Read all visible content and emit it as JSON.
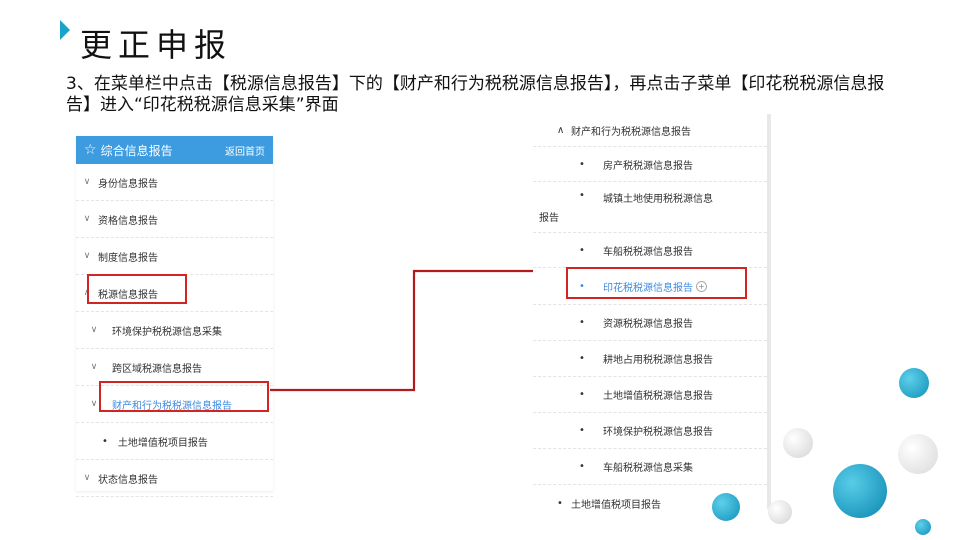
{
  "slide": {
    "title": "更正申报",
    "instruction": "3、在菜单栏中点击【税源信息报告】下的【财产和行为税税源信息报告】，再点击子菜单【印花税税源信息报告】进入“印花税税源信息采集”界面"
  },
  "left_menu": {
    "header_title": "综合信息报告",
    "home_link": "返回首页",
    "items": [
      {
        "arrow": "∨",
        "label": "身份信息报告"
      },
      {
        "arrow": "∨",
        "label": "资格信息报告"
      },
      {
        "arrow": "∨",
        "label": "制度信息报告"
      },
      {
        "arrow": "∧",
        "label": "税源信息报告"
      },
      {
        "arrow": "∨",
        "label": "环境保护税税源信息采集"
      },
      {
        "arrow": "∨",
        "label": "跨区域税源信息报告"
      },
      {
        "arrow": "∨",
        "label": "财产和行为税税源信息报告"
      },
      {
        "arrow": "•",
        "label": "土地增值税项目报告"
      },
      {
        "arrow": "∨",
        "label": "状态信息报告"
      }
    ]
  },
  "right_menu": {
    "parent": {
      "arrow": "∧",
      "label": "财产和行为税税源信息报告"
    },
    "items": [
      {
        "label": "房产税税源信息报告"
      },
      {
        "label": "城镇土地使用税税源信息",
        "wrap": "报告"
      },
      {
        "label": "车船税税源信息报告"
      },
      {
        "label": "印花税税源信息报告"
      },
      {
        "label": "资源税税源信息报告"
      },
      {
        "label": "耕地占用税税源信息报告"
      },
      {
        "label": "土地增值税税源信息报告"
      },
      {
        "label": "环境保护税税源信息报告"
      },
      {
        "label": "车船税税源信息采集"
      }
    ],
    "footer": {
      "label": "土地增值税项目报告"
    }
  },
  "colors": {
    "accent": "#1aa3c8",
    "menu_header": "#3d9be0",
    "highlight_box": "#d32424",
    "arrow": "#b01c1c",
    "selected_text": "#3d8be0"
  },
  "icons": [
    "triangle-marker-icon",
    "star-icon",
    "chevron-down-icon",
    "chevron-up-icon",
    "plus-circle-icon"
  ]
}
